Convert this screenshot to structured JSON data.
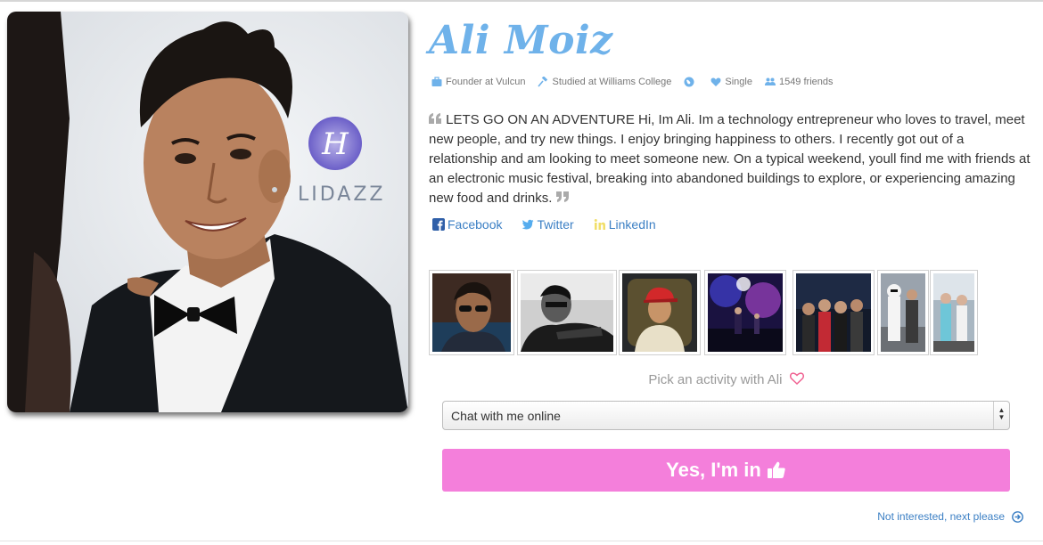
{
  "profile": {
    "name": "Ali Moiz",
    "meta": {
      "work": "Founder at Vulcun",
      "education": "Studied at Williams College",
      "relationship": "Single",
      "friends": "1549 friends"
    },
    "bio": "LETS GO ON AN ADVENTURE Hi, Im Ali. Im a technology entrepreneur who loves to travel, meet new people, and try new things. I enjoy bringing happiness to others. I recently got out of a relationship and am looking to meet someone new. On a typical weekend, youll find me with friends at an electronic music festival, breaking into abandoned buildings to explore, or experiencing amazing new food and drinks."
  },
  "social": {
    "facebook": "Facebook",
    "twitter": "Twitter",
    "linkedin": "LinkedIn"
  },
  "photo_logo_text": "LIDAZZ",
  "activity": {
    "prompt": "Pick an activity with Ali",
    "selected": "Chat with me online",
    "button": "Yes, I'm in",
    "skip": "Not interested, next please"
  },
  "colors": {
    "name_blue": "#6fb2ea",
    "link_blue": "#3b7fc4",
    "button_pink": "#f47fdb",
    "heart_pink": "#f06292"
  }
}
